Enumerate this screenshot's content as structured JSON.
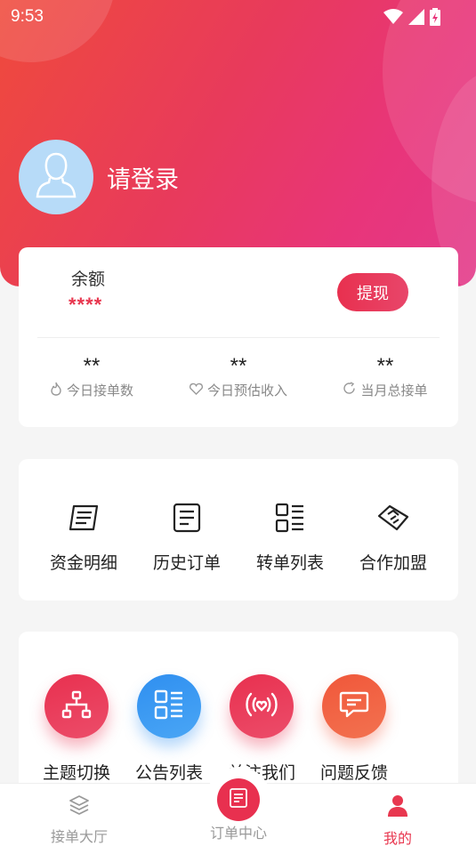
{
  "status": {
    "time": "9:53"
  },
  "profile": {
    "login_prompt": "请登录"
  },
  "balance": {
    "label": "余额",
    "value": "****",
    "withdraw_label": "提现"
  },
  "stats": [
    {
      "value": "**",
      "label": "今日接单数",
      "icon": "flame-icon"
    },
    {
      "value": "**",
      "label": "今日预估收入",
      "icon": "heart-icon"
    },
    {
      "value": "**",
      "label": "当月总接单",
      "icon": "refresh-icon"
    }
  ],
  "tools": [
    {
      "label": "资金明细",
      "icon": "ledger-icon"
    },
    {
      "label": "历史订单",
      "icon": "document-icon"
    },
    {
      "label": "转单列表",
      "icon": "list-icon"
    },
    {
      "label": "合作加盟",
      "icon": "handshake-icon"
    }
  ],
  "services": [
    {
      "label": "主题切换",
      "icon": "hierarchy-icon",
      "color": "#e8304f"
    },
    {
      "label": "公告列表",
      "icon": "list-icon",
      "color": "#2f8ff0"
    },
    {
      "label": "关注我们",
      "icon": "broadcast-heart-icon",
      "color": "#e8304f"
    },
    {
      "label": "问题反馈",
      "icon": "chat-icon",
      "color": "#f0573a"
    }
  ],
  "tabbar": {
    "items": [
      {
        "label": "接单大厅",
        "icon": "layers-icon",
        "active": false
      },
      {
        "label": "订单中心",
        "icon": "document-icon",
        "active": false
      },
      {
        "label": "我的",
        "icon": "person-icon",
        "active": true
      }
    ]
  },
  "colors": {
    "accent": "#e8304f",
    "hero_start": "#ef4a3c",
    "hero_end": "#e33a8a",
    "blue": "#2f8ff0",
    "orange": "#f0573a"
  }
}
